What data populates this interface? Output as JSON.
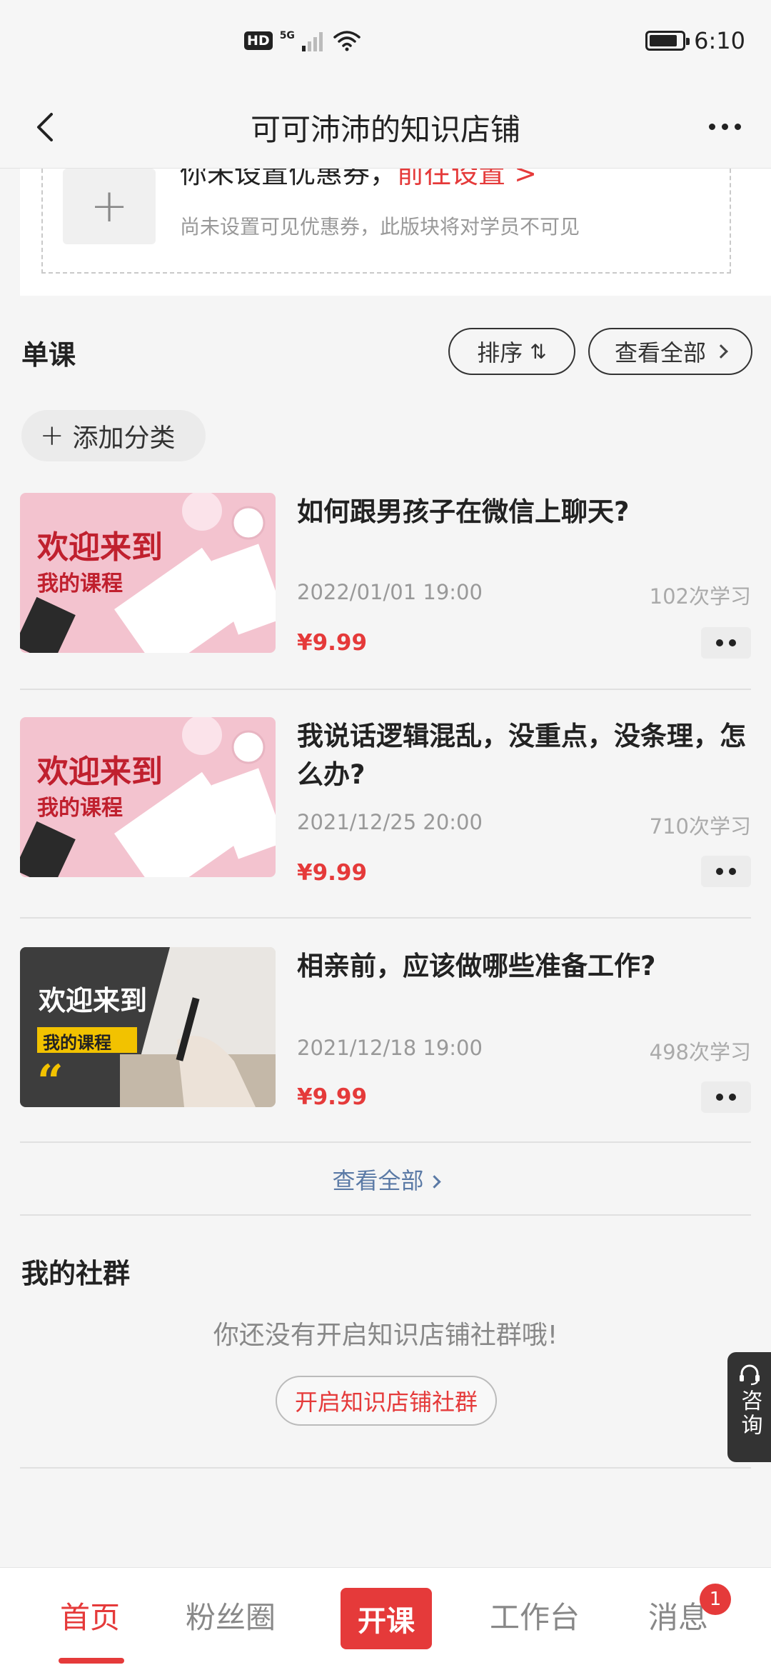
{
  "status_bar": {
    "hd": "HD",
    "network": "5G",
    "time": "6:10"
  },
  "nav": {
    "title": "可可沛沛的知识店铺"
  },
  "coupon": {
    "headline_prefix": "你未设置优惠券，",
    "headline_link": "前往设置 >",
    "subtext": "尚未设置可见优惠券，此版块将对学员不可见"
  },
  "single_course": {
    "title": "单课",
    "sort_label": "排序",
    "sort_symbol": "⇅",
    "view_all_label": "查看全部",
    "add_category_label": "添加分类"
  },
  "courses": [
    {
      "thumb_line1": "欢迎来到",
      "thumb_line2": "我的课程",
      "title": "如何跟男孩子在微信上聊天?",
      "date": "2022/01/01 19:00",
      "count": "102次学习",
      "price": "¥9.99"
    },
    {
      "thumb_line1": "欢迎来到",
      "thumb_line2": "我的课程",
      "title": "我说话逻辑混乱，没重点，没条理，怎么办?",
      "date": "2021/12/25 20:00",
      "count": "710次学习",
      "price": "¥9.99"
    },
    {
      "thumb_line1": "欢迎来到",
      "thumb_line2": "我的课程",
      "title": "相亲前，应该做哪些准备工作?",
      "date": "2021/12/18 19:00",
      "count": "498次学习",
      "price": "¥9.99"
    }
  ],
  "view_all_link": "查看全部",
  "community": {
    "title": "我的社群",
    "empty_text": "你还没有开启知识店铺社群哦!",
    "button_label": "开启知识店铺社群"
  },
  "consult": {
    "label": "咨询"
  },
  "tabs": [
    {
      "label": "首页"
    },
    {
      "label": "粉丝圈"
    },
    {
      "label": "开课"
    },
    {
      "label": "工作台"
    },
    {
      "label": "消息"
    }
  ],
  "message_badge": "1",
  "colors": {
    "accent": "#e53a3a",
    "link": "#5b7aa6",
    "pink_thumb": "#f3c3cf",
    "dark_thumb": "#3d3d3d"
  }
}
